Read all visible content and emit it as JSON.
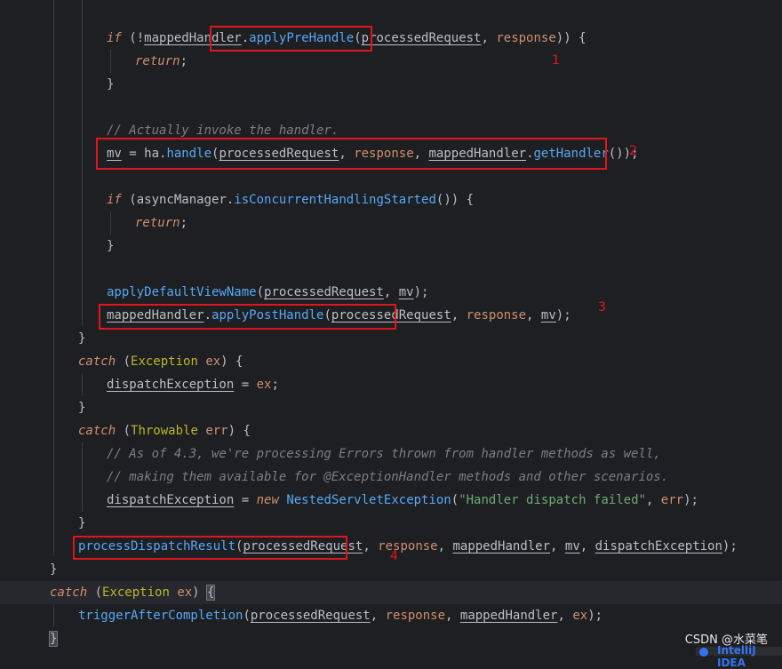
{
  "code_lines": [
    "if (!mappedHandler.applyPreHandle(processedRequest, response)) {",
    "return;",
    "}",
    "// Actually invoke the handler.",
    "mv = ha.handle(processedRequest, response, mappedHandler.getHandler());",
    "if (asyncManager.isConcurrentHandlingStarted()) {",
    "applyDefaultViewName(processedRequest, mv);",
    "mappedHandler.applyPostHandle(processedRequest, response, mv);",
    "catch (Exception ex) {",
    "dispatchException = ex;",
    "catch (Throwable err) {",
    "// As of 4.3, we're processing Errors thrown from handler methods as well,",
    "// making them available for @ExceptionHandler methods and other scenarios.",
    "dispatchException = new NestedServletException(\"Handler dispatch failed\", err);",
    "processDispatchResult(processedRequest, response, mappedHandler, mv, dispatchException);",
    "triggerAfterCompletion(processedRequest, response, mappedHandler, ex);"
  ],
  "tokens": {
    "kw_if": "if",
    "kw_return": "return",
    "kw_catch": "catch",
    "kw_new": "new",
    "mappedHandler": "mappedHandler",
    "processedRequest": "processedRequest",
    "response": "response",
    "mv": "mv",
    "ha": "ha",
    "asyncManager": "asyncManager",
    "dispatchException": "dispatchException",
    "ex": "ex",
    "err": "err",
    "Exception": "Exception",
    "Throwable": "Throwable",
    "NestedServletException": "NestedServletException",
    "applyPreHandle": "applyPreHandle",
    "handle": "handle",
    "getHandler": "getHandler",
    "isConcurrentHandlingStarted": "isConcurrentHandlingStarted",
    "applyDefaultViewName": "applyDefaultViewName",
    "applyPostHandle": "applyPostHandle",
    "processDispatchResult": "processDispatchResult",
    "triggerAfterCompletion": "triggerAfterCompletion",
    "comment_invoke": "// Actually invoke the handler.",
    "comment_errors_1": "// As of 4.3, we're processing Errors thrown from handler methods as well,",
    "comment_errors_2": "// making them available for @ExceptionHandler methods and other scenarios.",
    "str_dispatch_failed": "\"Handler dispatch failed\""
  },
  "annotations": [
    "1",
    "2",
    "3",
    "4"
  ],
  "watermark": "CSDN @水菜笔",
  "popup_peek": "IntelliJ IDEA",
  "colors": {
    "background": "#1e1f22",
    "current_line": "#26282e",
    "keyword": "#cf8e6d",
    "comment": "#7a7e85",
    "method": "#56a8f5",
    "string": "#6aab73",
    "class": "#bbb529",
    "annotation_red": "#e0161b"
  }
}
